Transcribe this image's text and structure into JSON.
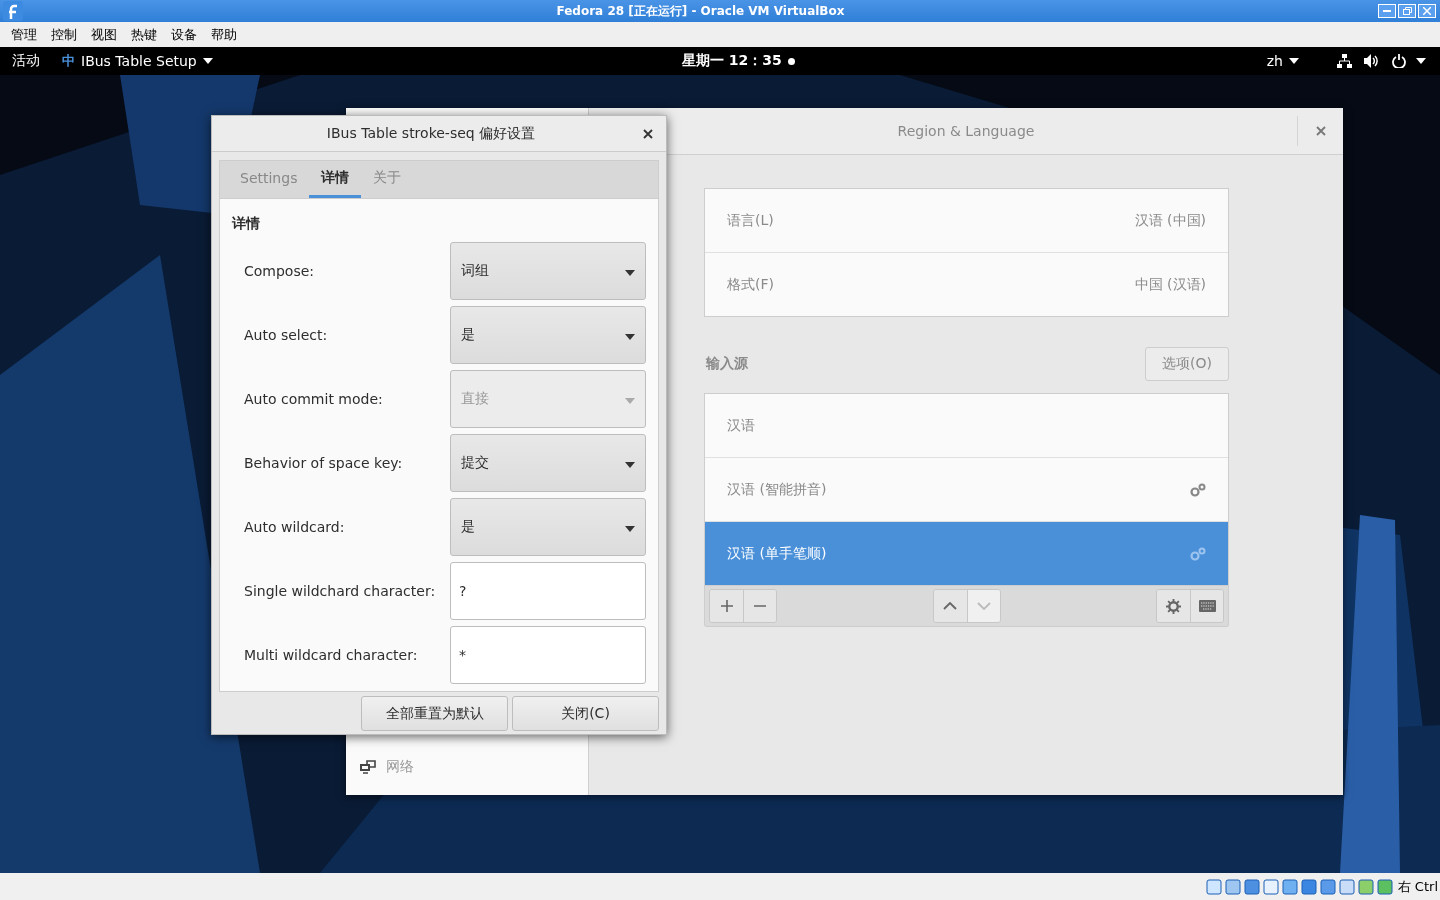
{
  "host_window": {
    "title": "Fedora 28 [正在运行] - Oracle VM VirtualBox"
  },
  "host_menu": [
    "管理",
    "控制",
    "视图",
    "热键",
    "设备",
    "帮助"
  ],
  "top_bar": {
    "activities": "活动",
    "app_badge": "中",
    "app_name": "IBus Table Setup",
    "clock": "星期一 12：35",
    "language": "zh"
  },
  "settings_window": {
    "title": "Region & Language",
    "sidebar_items": [
      {
        "label": "网络"
      }
    ],
    "language_rows": [
      {
        "label": "语言(L)",
        "value": "汉语 (中国)"
      },
      {
        "label": "格式(F)",
        "value": "中国 (汉语)"
      }
    ],
    "input_sources_heading": "输入源",
    "options_button": "选项(O)",
    "input_sources": [
      {
        "label": "汉语",
        "has_settings": false,
        "selected": false
      },
      {
        "label": "汉语 (智能拼音)",
        "has_settings": true,
        "selected": false
      },
      {
        "label": "汉语 (单手笔顺)",
        "has_settings": true,
        "selected": true
      }
    ],
    "toolbar": [
      {
        "kind": "add",
        "disabled": false
      },
      {
        "kind": "remove",
        "disabled": false
      },
      {
        "kind": "up",
        "disabled": false
      },
      {
        "kind": "down",
        "disabled": true
      },
      {
        "kind": "settings",
        "disabled": false
      },
      {
        "kind": "keyboard",
        "disabled": false
      }
    ]
  },
  "dialog": {
    "title": "IBus Table stroke-seq 偏好设置",
    "tabs": [
      {
        "label": "Settings",
        "selected": false
      },
      {
        "label": "详情",
        "selected": true
      },
      {
        "label": "关于",
        "selected": false
      }
    ],
    "section": "详情",
    "options": [
      {
        "label": "Compose:",
        "kind": "dropdown",
        "value": "词组",
        "disabled": false
      },
      {
        "label": "Auto select:",
        "kind": "dropdown",
        "value": "是",
        "disabled": false
      },
      {
        "label": "Auto commit mode:",
        "kind": "dropdown",
        "value": "直接",
        "disabled": true
      },
      {
        "label": "Behavior of space key:",
        "kind": "dropdown",
        "value": "提交",
        "disabled": false
      },
      {
        "label": "Auto wildcard:",
        "kind": "dropdown",
        "value": "是",
        "disabled": false
      },
      {
        "label": "Single wildchard character:",
        "kind": "entry",
        "value": "?",
        "disabled": false
      },
      {
        "label": "Multi wildcard character:",
        "kind": "entry",
        "value": "*",
        "disabled": false
      }
    ],
    "buttons": [
      "全部重置为默认",
      "关闭(C)"
    ]
  },
  "status_bar": {
    "host_key": "右 Ctrl"
  }
}
